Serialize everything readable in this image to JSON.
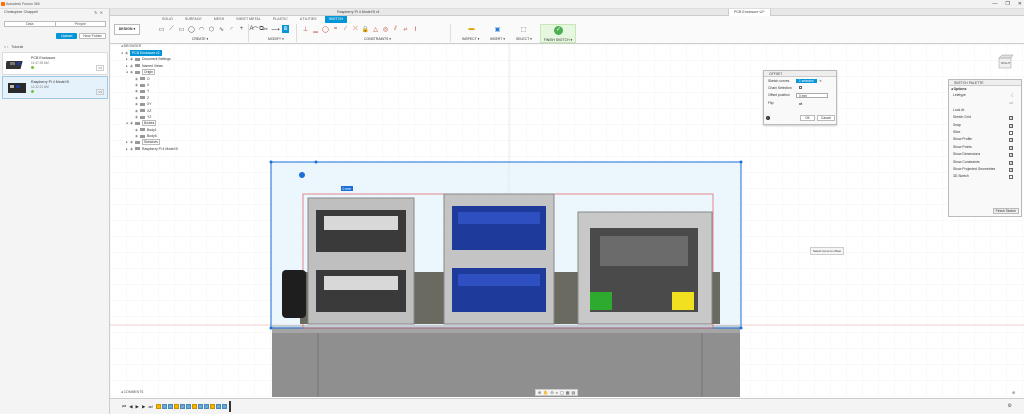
{
  "app": {
    "title": "Autodesk Fusion 360",
    "window_controls": [
      "—",
      "❐",
      "✕"
    ]
  },
  "data_panel": {
    "user": "Christopher Chappell",
    "tabs": [
      "Data",
      "People"
    ],
    "upload_label": "Upload",
    "new_folder_label": "New Folder",
    "breadcrumb": "Tutorial",
    "files": [
      {
        "name": "PCB Enclosure",
        "time": "11:47:25 AM",
        "version": "V2"
      },
      {
        "name": "Raspberry Pi 4 Model B",
        "time": "11:32:21 AM",
        "version": "V1"
      }
    ]
  },
  "doc_tabs": [
    {
      "label": "Raspberry Pi 4 Model B v1",
      "active": false
    },
    {
      "label": "PCB Enclosure v2*",
      "active": true
    }
  ],
  "ribbon": {
    "design_label": "DESIGN ▾",
    "tabs": [
      {
        "label": "SOLID",
        "active": false
      },
      {
        "label": "SURFACE",
        "active": false
      },
      {
        "label": "MESH",
        "active": false
      },
      {
        "label": "SHEET METAL",
        "active": false
      },
      {
        "label": "PLASTIC",
        "active": false
      },
      {
        "label": "UTILITIES",
        "active": false
      },
      {
        "label": "SKETCH",
        "active": true
      }
    ],
    "groups": {
      "create": "CREATE ▾",
      "modify": "MODIFY ▾",
      "constraints": "CONSTRAINTS ▾",
      "inspect": "INSPECT ▾",
      "insert": "INSERT ▾",
      "select": "SELECT ▾",
      "finish": "FINISH SKETCH ▾"
    }
  },
  "browser": {
    "header": "BROWSER",
    "root": "PCB Enclosure v2",
    "items": [
      {
        "label": "Document Settings",
        "depth": 1,
        "tw": "▸"
      },
      {
        "label": "Named Views",
        "depth": 1,
        "tw": "▸"
      },
      {
        "label": "Origin",
        "depth": 1,
        "tw": "◂",
        "boxed": true
      },
      {
        "label": "O",
        "depth": 2,
        "tw": ""
      },
      {
        "label": "X",
        "depth": 2,
        "tw": ""
      },
      {
        "label": "Y",
        "depth": 2,
        "tw": ""
      },
      {
        "label": "Z",
        "depth": 2,
        "tw": ""
      },
      {
        "label": "XY",
        "depth": 2,
        "tw": ""
      },
      {
        "label": "XZ",
        "depth": 2,
        "tw": ""
      },
      {
        "label": "YZ",
        "depth": 2,
        "tw": ""
      },
      {
        "label": "Bodies",
        "depth": 1,
        "tw": "◂",
        "boxed": true
      },
      {
        "label": "Body1",
        "depth": 2,
        "tw": ""
      },
      {
        "label": "Body6",
        "depth": 2,
        "tw": ""
      },
      {
        "label": "Sketches",
        "depth": 1,
        "tw": "▸",
        "boxed": true
      },
      {
        "label": "Raspberry Pi 4 Model B",
        "depth": 1,
        "tw": "▸"
      }
    ]
  },
  "offset_dialog": {
    "title": "OFFSET",
    "sketch_curves_label": "Sketch curves",
    "sketch_curves_value": "1 selected",
    "chain_selection_label": "Chain Selection",
    "offset_position_label": "Offset position",
    "offset_position_value": "0 mm",
    "flip_label": "Flip",
    "ok_label": "OK",
    "cancel_label": "Cancel"
  },
  "sketch_palette": {
    "title": "SKETCH PALETTE",
    "options_label": "Options",
    "rows": [
      {
        "label": "Linetype",
        "kind": "glyph",
        "glyph": "〈"
      },
      {
        "label": "",
        "kind": "glyph",
        "glyph": "▭"
      },
      {
        "label": "Look At",
        "kind": "glyph",
        "glyph": ""
      },
      {
        "label": "Sketch Grid",
        "kind": "chk"
      },
      {
        "label": "Snap",
        "kind": "chk"
      },
      {
        "label": "Slice",
        "kind": "box"
      },
      {
        "label": "Show Profile",
        "kind": "chk"
      },
      {
        "label": "Show Points",
        "kind": "chk"
      },
      {
        "label": "Show Dimensions",
        "kind": "chk"
      },
      {
        "label": "Show Constraints",
        "kind": "chk"
      },
      {
        "label": "Show Projected Geometries",
        "kind": "chk"
      },
      {
        "label": "3D Sketch",
        "kind": "box"
      }
    ],
    "finish_label": "Finish Sketch"
  },
  "canvas": {
    "tooltip": "Select curve to offset",
    "dimension_label": "0 mm",
    "viewcube_label": "RIGHT",
    "colors": {
      "sketch_line": "#1a6fd8",
      "red_axis": "#e05a5a",
      "usb_blue": "#1e3a9a",
      "led_green": "#2eaa2e",
      "led_yellow": "#f0e020"
    }
  },
  "bottom": {
    "comments_label": "COMMENTS",
    "nav_icons": [
      "⊕",
      "✋",
      "⊖",
      "⌕",
      "▢",
      "▦",
      "▤"
    ],
    "timeline_controls": [
      "⏮",
      "◀",
      "▶",
      "▶",
      "⏭"
    ]
  }
}
